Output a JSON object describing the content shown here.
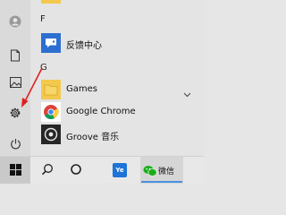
{
  "start_menu": {
    "sections": [
      {
        "letter": "F",
        "items": [
          {
            "label": "反馈中心",
            "icon": "feedback-hub-icon"
          }
        ]
      },
      {
        "letter": "G",
        "items": [
          {
            "label": "Games",
            "icon": "folder-icon",
            "expandable": true
          },
          {
            "label": "Google Chrome",
            "icon": "chrome-icon"
          },
          {
            "label": "Groove 音乐",
            "icon": "groove-music-icon"
          }
        ]
      }
    ],
    "rail": [
      "user-icon",
      "document-icon",
      "pictures-icon",
      "settings-icon",
      "power-icon"
    ]
  },
  "taskbar": {
    "items": [
      "start-windows-icon",
      "search-icon",
      "cortana-icon",
      "app-ye-icon",
      "wechat-icon"
    ],
    "wechat_label": "微信",
    "ye_text": "Ye"
  },
  "colors": {
    "accent_blue": "#4a90e2",
    "arrow_red": "#e02020",
    "folder_yellow": "#f2c94c",
    "feedback_blue": "#2d6fd1",
    "wechat_green": "#1aad19"
  }
}
